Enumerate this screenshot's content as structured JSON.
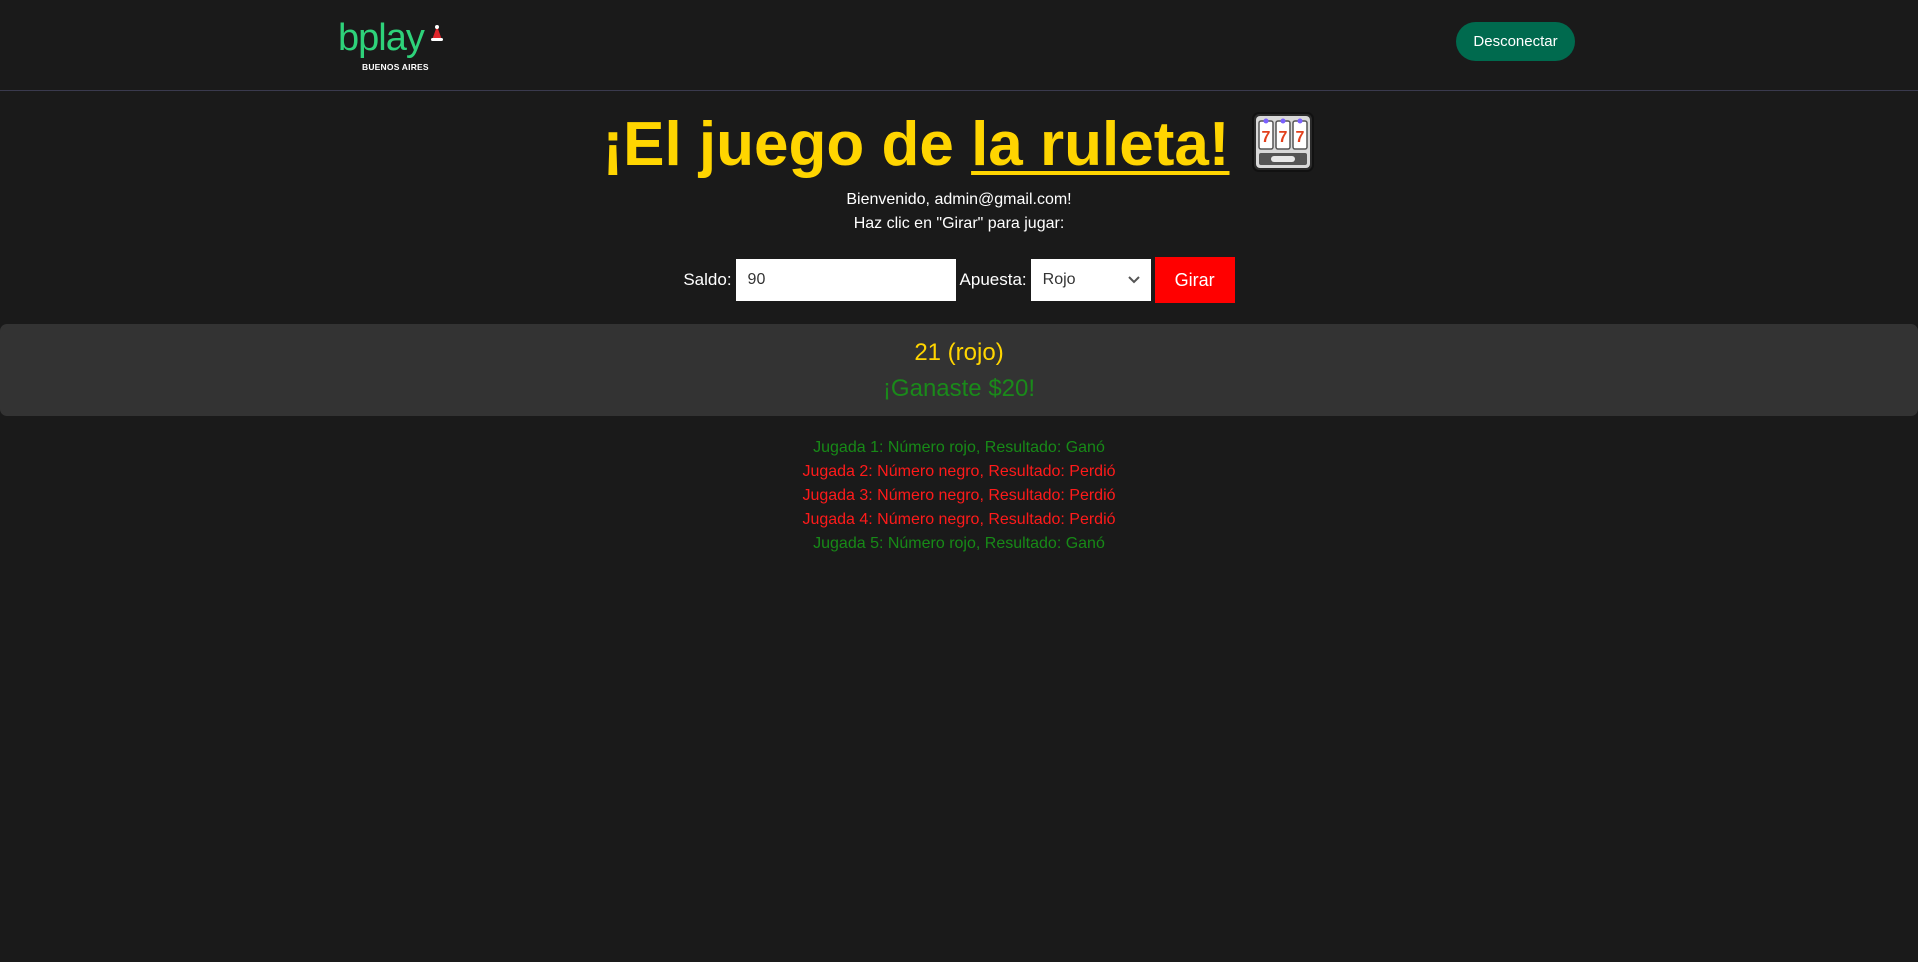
{
  "header": {
    "logo_text": "bplay",
    "logo_subtext": "BUENOS AIRES",
    "logout_label": "Desconectar"
  },
  "title": {
    "part1": "¡El juego de ",
    "part2": "la ruleta!",
    "icon": "slot-machine-icon"
  },
  "welcome": "Bienvenido, admin@gmail.com!",
  "instructions": "Haz clic en \"Girar\" para jugar:",
  "controls": {
    "saldo_label": "Saldo:",
    "saldo_value": "90",
    "apuesta_label": "Apuesta:",
    "apuesta_selected": "Rojo",
    "girar_label": "Girar"
  },
  "result": {
    "number_text": "21 (rojo)",
    "message": "¡Ganaste $20!"
  },
  "history": [
    {
      "text": "Jugada 1: Número rojo, Resultado: Ganó",
      "status": "win"
    },
    {
      "text": "Jugada 2: Número negro, Resultado: Perdió",
      "status": "loss"
    },
    {
      "text": "Jugada 3: Número negro, Resultado: Perdió",
      "status": "loss"
    },
    {
      "text": "Jugada 4: Número negro, Resultado: Perdió",
      "status": "loss"
    },
    {
      "text": "Jugada 5: Número rojo, Resultado: Ganó",
      "status": "win"
    }
  ],
  "colors": {
    "background": "#1a1a1a",
    "title": "#ffd500",
    "logo": "#2ed27a",
    "logout_button": "#006a4e",
    "girar_button": "#ff0000",
    "win": "#178a17",
    "loss": "#ff1a1a"
  }
}
